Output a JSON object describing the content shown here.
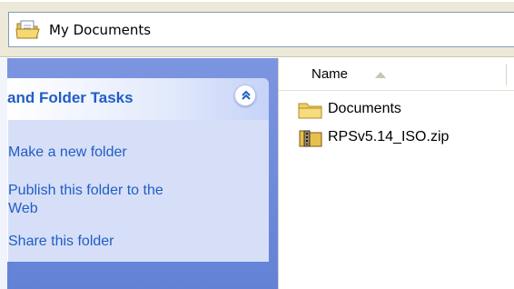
{
  "address_bar": {
    "icon": "open-folder-icon",
    "path": "My Documents"
  },
  "task_pane": {
    "title": "and Folder Tasks",
    "collapse_icon": "double-chevron-up-icon",
    "tasks": [
      {
        "label": "Make a new folder"
      },
      {
        "label": "Publish this folder to the"
      },
      {
        "label": "Web"
      },
      {
        "label": "Share this folder"
      }
    ],
    "colors": {
      "pane": "#6f89d8",
      "box_body": "#d6dff7",
      "link": "#215dc6"
    }
  },
  "file_list": {
    "column": "Name",
    "sort_icon": "sort-ascending-icon",
    "items": [
      {
        "name": "Documents",
        "icon": "folder-icon"
      },
      {
        "name": "RPSv5.14_ISO.zip",
        "icon": "zip-archive-icon"
      }
    ]
  }
}
